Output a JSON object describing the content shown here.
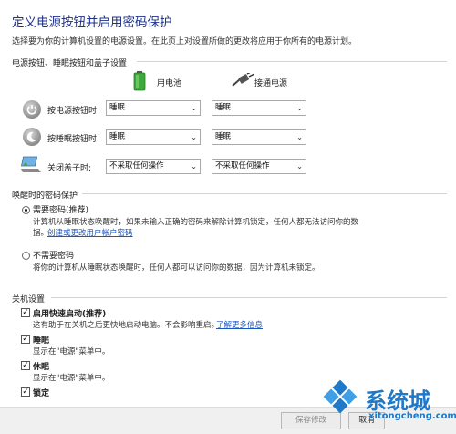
{
  "header": {
    "title": "定义电源按钮并启用密码保护",
    "description": "选择要为你的计算机设置的电源设置。在此页上对设置所做的更改将应用于你所有的电源计划。"
  },
  "buttons_section": {
    "heading": "电源按钮、睡眠按钮和盖子设置",
    "col_battery": "用电池",
    "col_plugged": "接通电源",
    "rows": [
      {
        "label": "按电源按钮时:",
        "battery": "睡眠",
        "plugged": "睡眠"
      },
      {
        "label": "按睡眠按钮时:",
        "battery": "睡眠",
        "plugged": "睡眠"
      },
      {
        "label": "关闭盖子时:",
        "battery": "不采取任何操作",
        "plugged": "不采取任何操作"
      }
    ]
  },
  "password_section": {
    "heading": "唤醒时的密码保护",
    "require": {
      "label": "需要密码(推荐)",
      "desc_line1": "计算机从睡眠状态唤醒时，如果未输入正确的密码来解除计算机锁定，任何人都无法访问你的数",
      "desc_line2": "据。",
      "link": "创建或更改用户帐户密码",
      "selected": true
    },
    "no_require": {
      "label": "不需要密码",
      "desc": "将你的计算机从睡眠状态唤醒时，任何人都可以访问你的数据，因为计算机未锁定。",
      "selected": false
    }
  },
  "shutdown_section": {
    "heading": "关机设置",
    "items": [
      {
        "label": "启用快速启动(推荐)",
        "desc": "这有助于在关机之后更快地启动电脑。不会影响重启。",
        "link": "了解更多信息",
        "checked": true
      },
      {
        "label": "睡眠",
        "desc": "显示在\"电源\"菜单中。",
        "checked": true
      },
      {
        "label": "休眠",
        "desc": "显示在\"电源\"菜单中。",
        "checked": true
      },
      {
        "label": "锁定",
        "desc": "",
        "checked": true
      }
    ]
  },
  "footer": {
    "save_label": "保存修改",
    "cancel_label": "取消"
  },
  "watermark": {
    "text": "系统城",
    "url": "xitongcheng.com"
  },
  "colors": {
    "title": "#1e3287",
    "link": "#1a56c2",
    "battery_green": "#3ea83a",
    "watermark_blue": "#1f78c8"
  }
}
